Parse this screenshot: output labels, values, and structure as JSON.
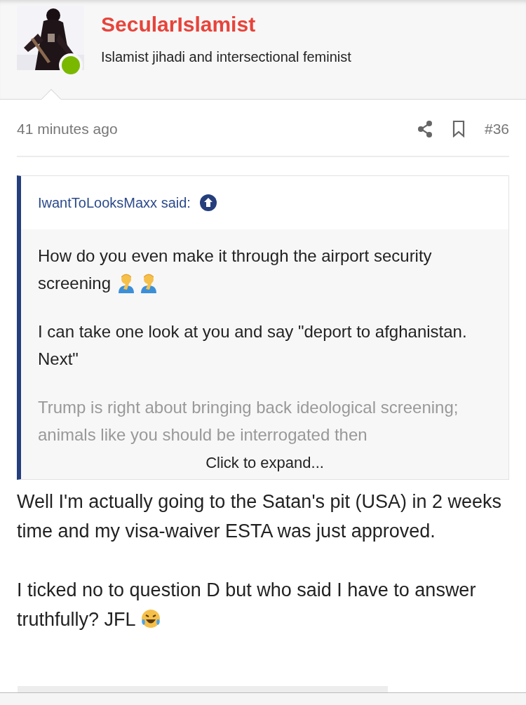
{
  "author": {
    "name": "SecularIslamist",
    "title": "Islamist jihadi and intersectional feminist",
    "online": true
  },
  "post": {
    "time": "41 minutes ago",
    "number": "#36",
    "quote": {
      "header": "IwantToLooksMaxx said:",
      "paragraphs": [
        {
          "text": "How do you even make it through the airport security screening",
          "faded": false,
          "emoji": [
            {
              "kind": "facepalm"
            },
            {
              "kind": "facepalm"
            }
          ]
        },
        {
          "text": "I can take one look at you and say \"deport to afghanistan. Next\"",
          "faded": false
        },
        {
          "text": "Trump is right about bringing back ideological screening; animals like you should be interrogated then",
          "faded": true
        }
      ],
      "expand": "Click to expand..."
    },
    "paragraphs": [
      {
        "text": "Well I'm actually going to the Satan's pit (USA) in 2 weeks time and my visa-waiver ESTA was just approved."
      },
      {
        "text": "I ticked no to question D but who said I have to answer truthfully? JFL",
        "emoji": [
          {
            "kind": "laughing-tears"
          }
        ]
      }
    ]
  }
}
